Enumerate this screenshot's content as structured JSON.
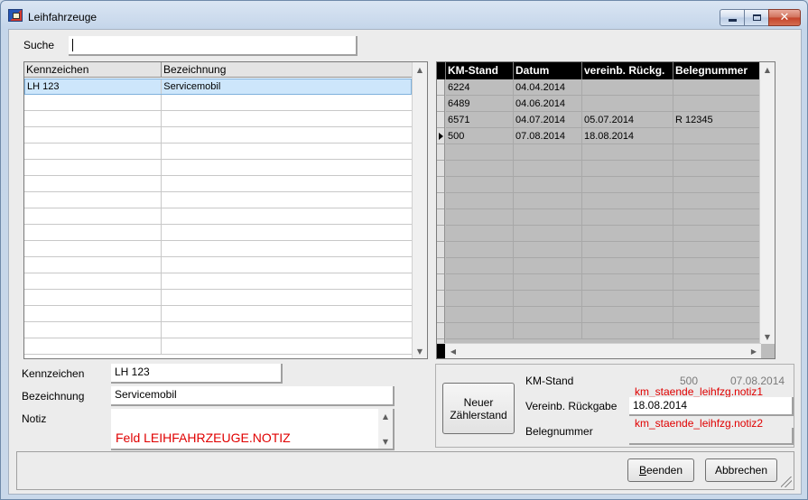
{
  "window": {
    "title": "Leihfahrzeuge",
    "controls": {
      "minimize": "minimize",
      "maximize": "maximize",
      "close": "✕"
    }
  },
  "search": {
    "label": "Suche",
    "value": ""
  },
  "vehicles_grid": {
    "headers": [
      "Kennzeichen",
      "Bezeichnung"
    ],
    "rows": [
      [
        "LH 123",
        "Servicemobil"
      ],
      [
        "",
        ""
      ],
      [
        "",
        ""
      ],
      [
        "",
        ""
      ],
      [
        "",
        ""
      ],
      [
        "",
        ""
      ],
      [
        "",
        ""
      ],
      [
        "",
        ""
      ],
      [
        "",
        ""
      ],
      [
        "",
        ""
      ],
      [
        "",
        ""
      ],
      [
        "",
        ""
      ],
      [
        "",
        ""
      ],
      [
        "",
        ""
      ],
      [
        "",
        ""
      ],
      [
        "",
        ""
      ],
      [
        "",
        ""
      ]
    ]
  },
  "odometer_grid": {
    "headers": [
      "KM-Stand",
      "Datum",
      "vereinb. Rückg.",
      "Belegnummer"
    ],
    "rows": [
      [
        "6224",
        "04.04.2014",
        "",
        ""
      ],
      [
        "6489",
        "04.06.2014",
        "",
        ""
      ],
      [
        "6571",
        "04.07.2014",
        "05.07.2014",
        "R 12345"
      ],
      [
        "500",
        "07.08.2014",
        "18.08.2014",
        ""
      ],
      [
        "",
        "",
        "",
        ""
      ],
      [
        "",
        "",
        "",
        ""
      ],
      [
        "",
        "",
        "",
        ""
      ],
      [
        "",
        "",
        "",
        ""
      ],
      [
        "",
        "",
        "",
        ""
      ],
      [
        "",
        "",
        "",
        ""
      ],
      [
        "",
        "",
        "",
        ""
      ],
      [
        "",
        "",
        "",
        ""
      ],
      [
        "",
        "",
        "",
        ""
      ],
      [
        "",
        "",
        "",
        ""
      ],
      [
        "",
        "",
        "",
        ""
      ],
      [
        "",
        "",
        "",
        ""
      ]
    ],
    "current_row": 3
  },
  "details": {
    "kennzeichen_label": "Kennzeichen",
    "kennzeichen_value": "LH 123",
    "bezeichnung_label": "Bezeichnung",
    "bezeichnung_value": "Servicemobil",
    "notiz_label": "Notiz",
    "notiz_value": "Feld LEIHFAHRZEUGE.NOTIZ"
  },
  "meter_group": {
    "new_button_line1": "Neuer",
    "new_button_line2": "Zählerstand",
    "km_label": "KM-Stand",
    "km_value": "500",
    "km_date": "07.08.2014",
    "return_label": "Vereinb. Rückgabe",
    "return_note": "km_staende_leihfzg.notiz1",
    "return_value": "18.08.2014",
    "beleg_label": "Belegnummer",
    "beleg_note": "km_staende_leihfzg.notiz2",
    "beleg_value": ""
  },
  "footer": {
    "end_label_first": "B",
    "end_label_rest": "eenden",
    "cancel_label": "Abbrechen"
  },
  "colors": {
    "selection": "#cde6fb",
    "grid_header_dark": "#000000",
    "annotation_red": "#e00000"
  }
}
